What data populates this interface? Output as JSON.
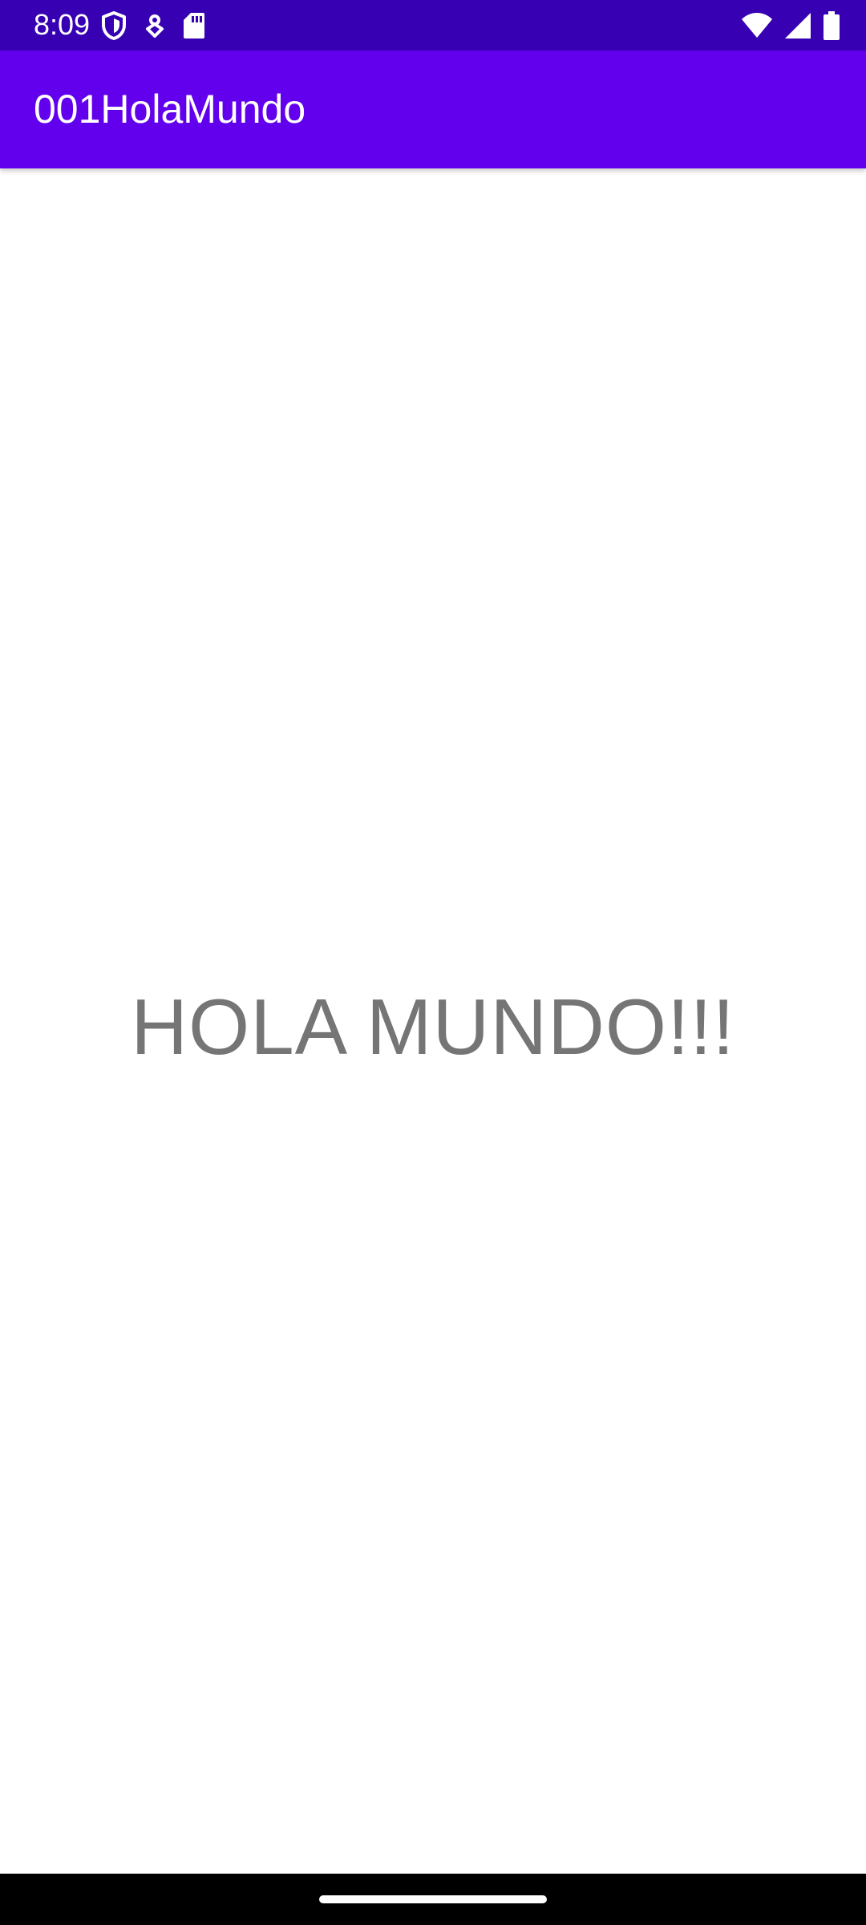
{
  "status_bar": {
    "time": "8:09",
    "left_icons": [
      "shield-icon",
      "location-pin-icon",
      "sd-card-icon"
    ],
    "right_icons": [
      "wifi-icon",
      "signal-icon",
      "battery-icon"
    ],
    "background": "#3700b3"
  },
  "app_bar": {
    "title": "001HolaMundo",
    "background": "#6200ee"
  },
  "main": {
    "message": "HOLA MUNDO!!!",
    "message_color": "#757575"
  },
  "nav_bar": {
    "background": "#000000"
  }
}
